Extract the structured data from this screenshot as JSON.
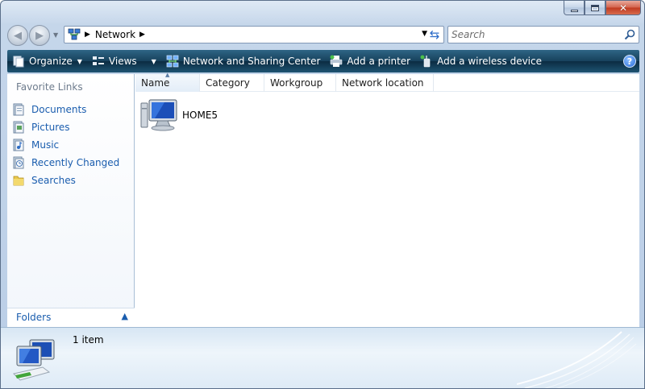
{
  "window": {
    "caption": {
      "minimize_icon": "minimize-icon",
      "maximize_icon": "maximize-icon",
      "close_icon": "close-icon"
    }
  },
  "nav": {
    "back_icon": "back-arrow-icon",
    "forward_icon": "forward-arrow-icon",
    "recent_icon": "chevron-down-icon"
  },
  "address": {
    "location_icon": "network-icon",
    "location": "Network",
    "refresh_icon": "refresh-icon"
  },
  "search": {
    "placeholder": "Search",
    "icon": "magnifier-icon"
  },
  "toolbar": {
    "organize": "Organize",
    "views": "Views",
    "network_sharing_center": "Network and Sharing Center",
    "add_printer": "Add a printer",
    "add_wireless_device": "Add a wireless device",
    "help_icon": "help-icon"
  },
  "sidebar": {
    "title": "Favorite Links",
    "items": [
      {
        "label": "Documents",
        "icon": "documents-icon"
      },
      {
        "label": "Pictures",
        "icon": "pictures-icon"
      },
      {
        "label": "Music",
        "icon": "music-icon"
      },
      {
        "label": "Recently Changed",
        "icon": "recently-changed-icon"
      },
      {
        "label": "Searches",
        "icon": "searches-folder-icon"
      }
    ],
    "folders_label": "Folders"
  },
  "columns": [
    "Name",
    "Category",
    "Workgroup",
    "Network location"
  ],
  "sorted_column": "Name",
  "items": [
    {
      "name": "HOME5",
      "icon": "computer-icon"
    }
  ],
  "details": {
    "count": "1 item",
    "icon": "network-computers-icon"
  },
  "colors": {
    "toolbar": "#17415c",
    "link": "#1a5dae",
    "frame": "#c5d6ea"
  }
}
